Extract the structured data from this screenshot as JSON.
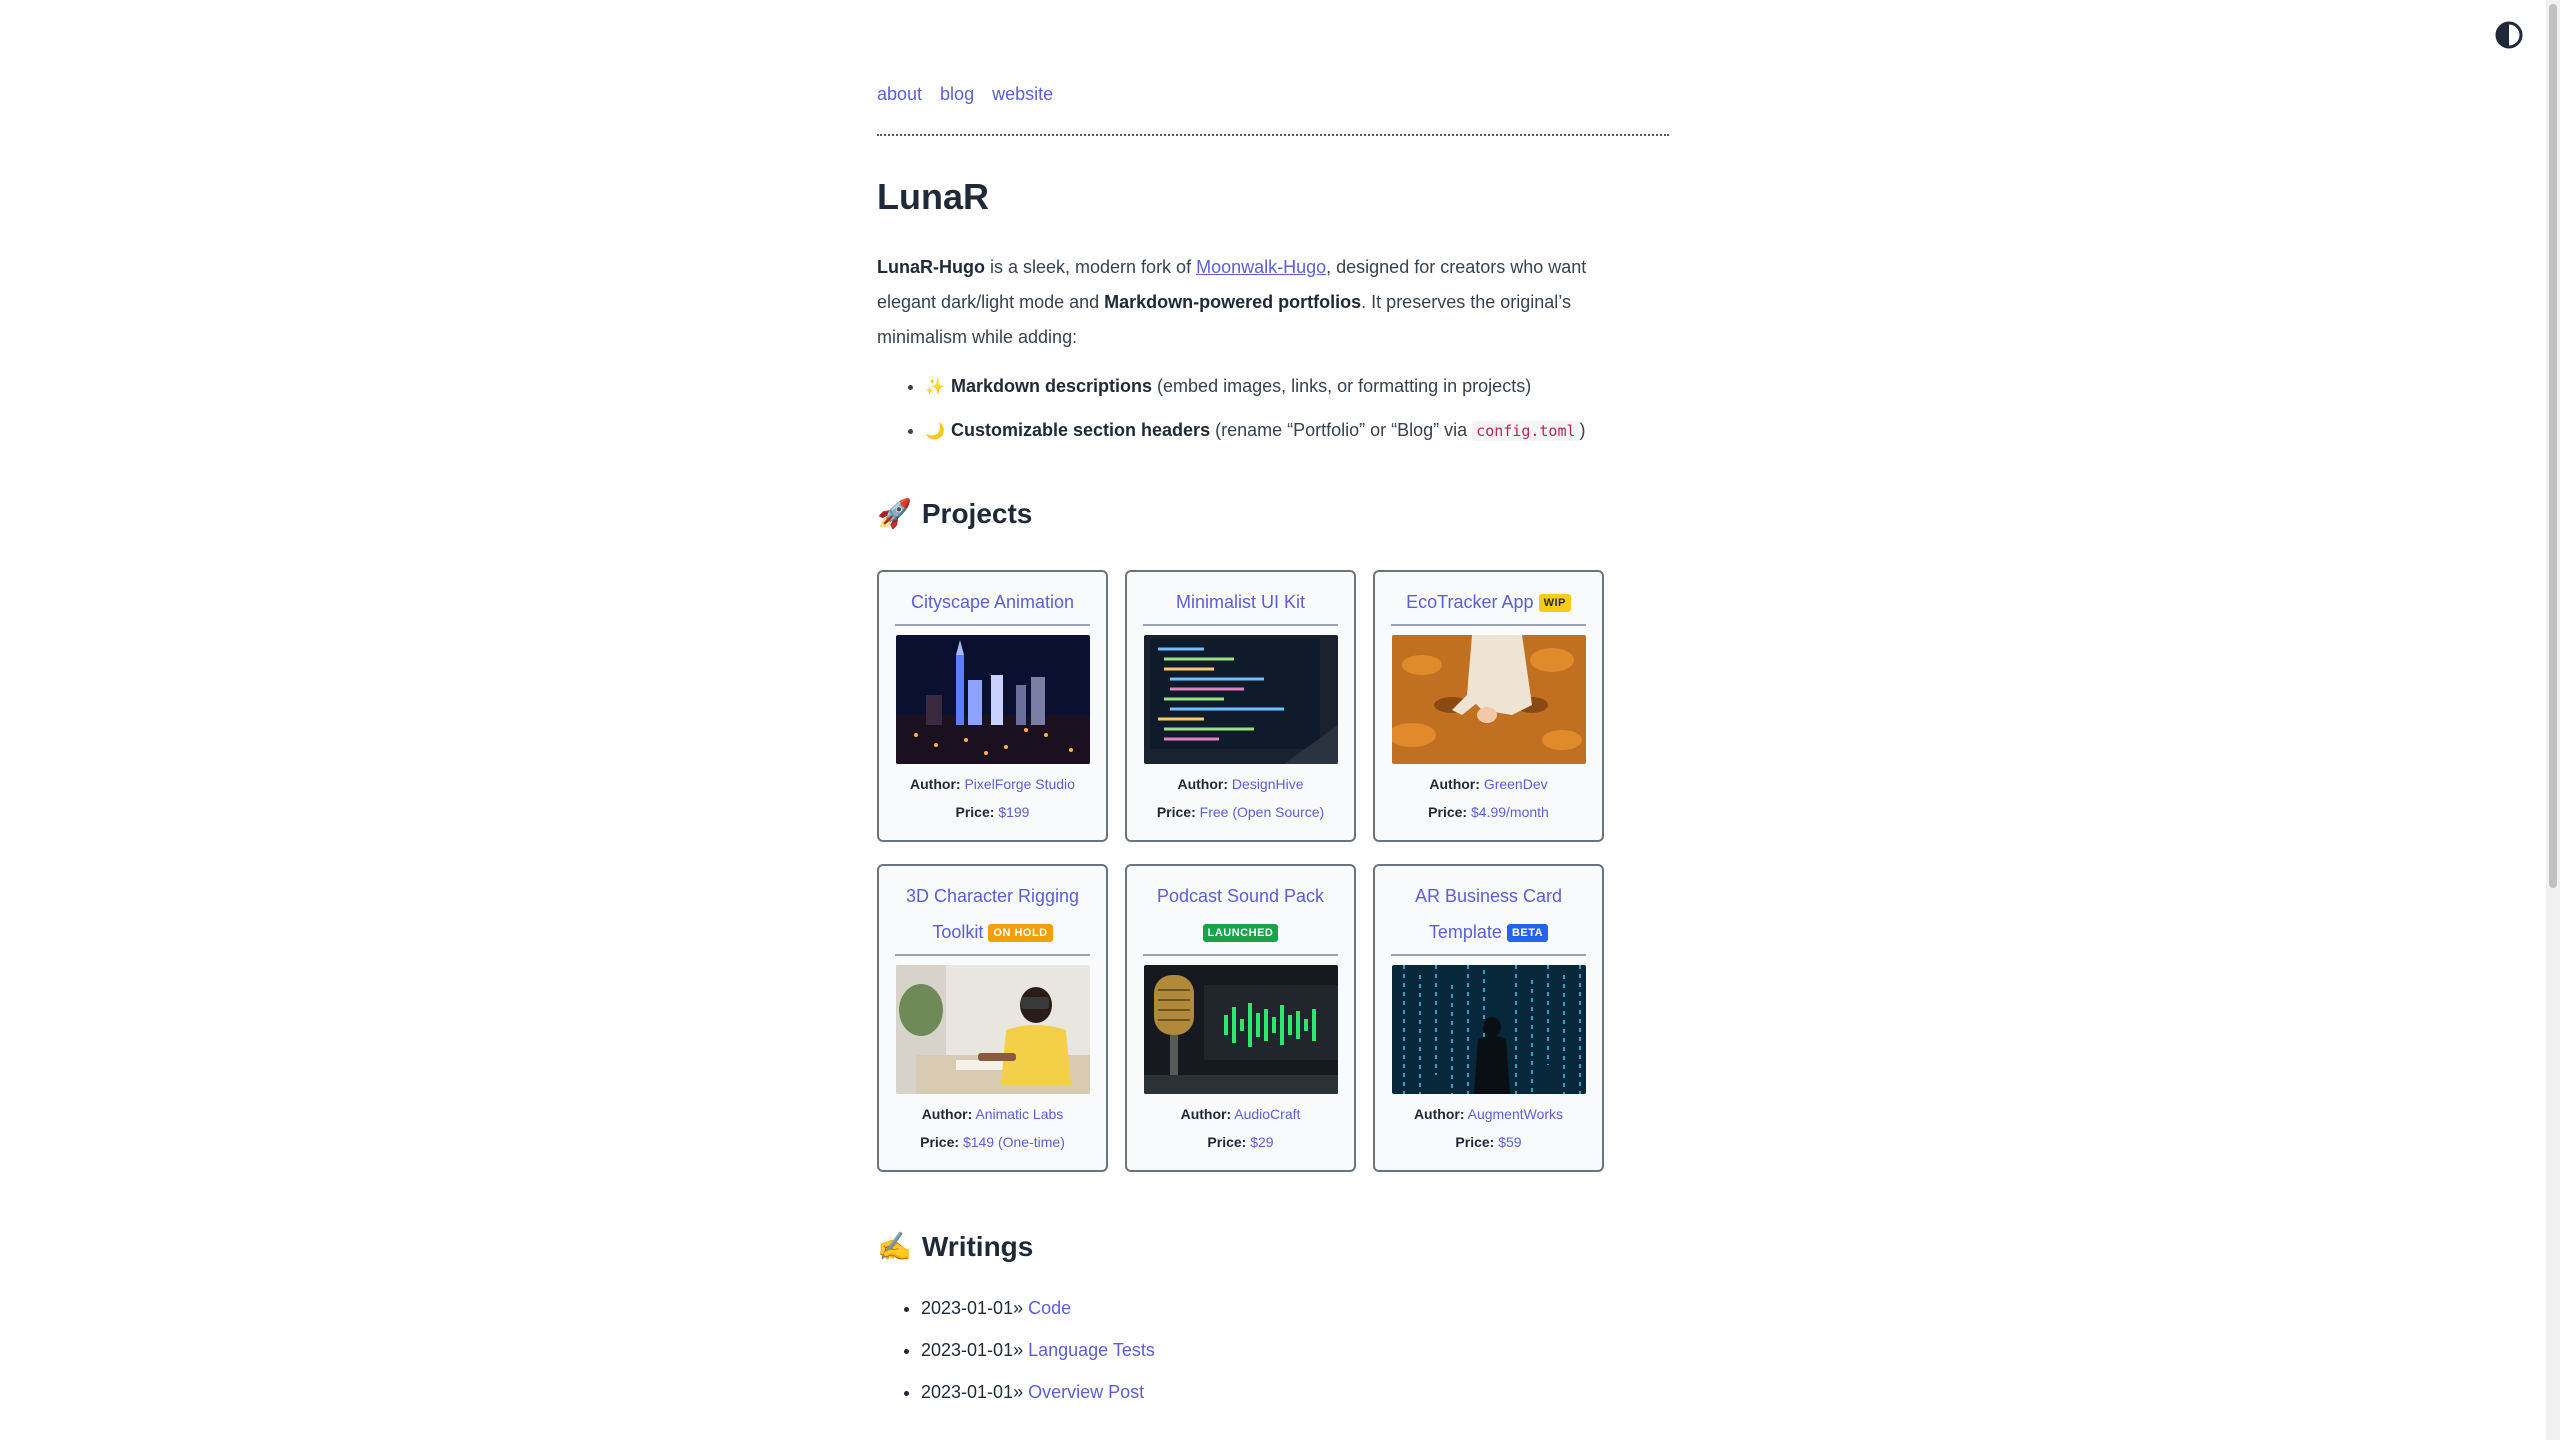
{
  "nav": [
    {
      "label": "about"
    },
    {
      "label": "blog"
    },
    {
      "label": "website"
    }
  ],
  "title": "LunaR",
  "intro": {
    "brand": "LunaR-Hugo",
    "t1": " is a sleek, modern fork of ",
    "link": "Moonwalk-Hugo",
    "t2": ", designed for creators who want elegant dark/light mode and ",
    "bold2": "Markdown-powered portfolios",
    "t3": ". It preserves the original’s minimalism while adding:"
  },
  "features": [
    {
      "emoji": "✨",
      "bold": "Markdown descriptions",
      "text": " (embed images, links, or formatting in projects)"
    },
    {
      "emoji": "🌙",
      "bold": "Customizable section headers",
      "text": " (rename “Portfolio” or “Blog” via ",
      "code": "config.toml",
      "after": ")"
    }
  ],
  "projects_heading": {
    "emoji": "🚀",
    "label": "Projects"
  },
  "projects": [
    {
      "title": "Cityscape Animation",
      "badge": "",
      "author_label": "Author:",
      "author": "PixelForge Studio",
      "price_label": "Price:",
      "price": "$199",
      "image": "city-night"
    },
    {
      "title": "Minimalist UI Kit",
      "badge": "",
      "author_label": "Author:",
      "author": "DesignHive",
      "price_label": "Price:",
      "price": "Free (Open Source)",
      "image": "code-monitor"
    },
    {
      "title": "EcoTracker App",
      "badge": "WIP",
      "author_label": "Author:",
      "author": "GreenDev",
      "price_label": "Price:",
      "price": "$4.99/month",
      "image": "autumn-leaves"
    },
    {
      "title": "3D Character Rigging Toolkit",
      "badge": "ON HOLD",
      "author_label": "Author:",
      "author": "Animatic Labs",
      "price_label": "Price:",
      "price": "$149 (One-time)",
      "image": "vr-headset"
    },
    {
      "title": "Podcast Sound Pack",
      "badge": "LAUNCHED",
      "author_label": "Author:",
      "author": "AudioCraft",
      "price_label": "Price:",
      "price": "$29",
      "image": "microphone"
    },
    {
      "title": "AR Business Card Template",
      "badge": "BETA",
      "author_label": "Author:",
      "author": "AugmentWorks",
      "price_label": "Price:",
      "price": "$59",
      "image": "matrix-code"
    }
  ],
  "writings_heading": {
    "emoji": "✍️",
    "label": "Writings"
  },
  "posts": [
    {
      "date": "2023-01-01»",
      "title": "Code"
    },
    {
      "date": "2023-01-01»",
      "title": "Language Tests"
    },
    {
      "date": "2023-01-01»",
      "title": "Overview Post"
    }
  ],
  "icons": {
    "theme_toggle": "half-circle-contrast-icon"
  },
  "colors": {
    "link": "#5a5fd6",
    "wip": "#facc15",
    "on_hold": "#f59e0b",
    "launched": "#16a34a",
    "beta": "#2563eb"
  }
}
